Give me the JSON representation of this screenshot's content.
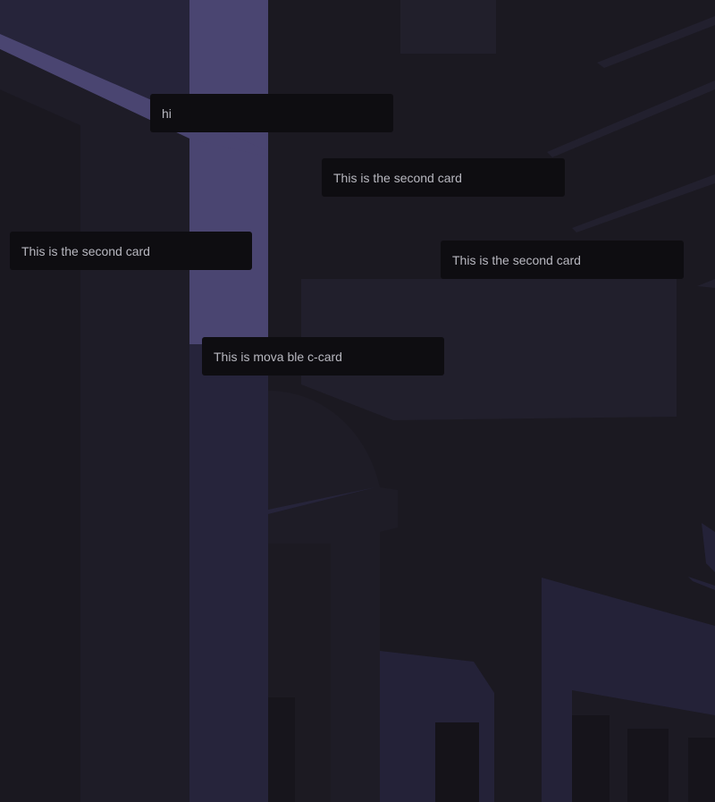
{
  "colors": {
    "background": "#1b1922",
    "card_background": "#0e0d11",
    "card_text": "#b8b8c0",
    "accent_purple": "#4b4570"
  },
  "cards": [
    {
      "label": "hi"
    },
    {
      "label": "This is the second card"
    },
    {
      "label": "This is the second card"
    },
    {
      "label": "This is the second card"
    },
    {
      "label": "This is mova ble c-card"
    }
  ]
}
